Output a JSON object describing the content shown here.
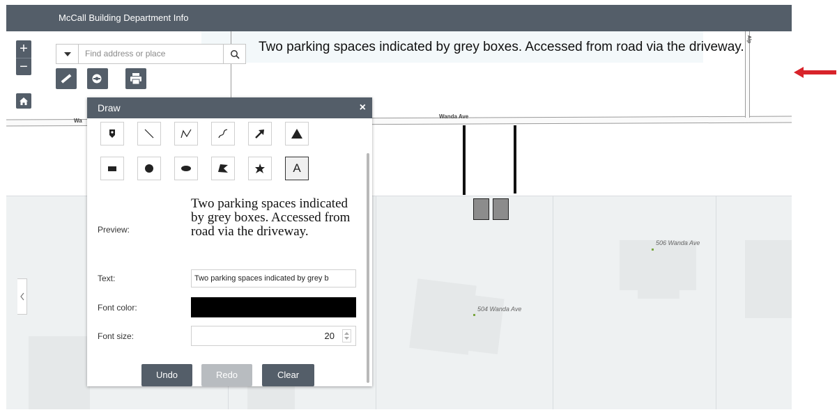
{
  "header": {
    "title": "McCall Building Department Info"
  },
  "map": {
    "annotation_text": "Two parking spaces indicated by grey boxes. Accessed from road via the driveway.",
    "street_name": "Wanda Ave",
    "street_name_left": "Wa",
    "street_vertical": "Alp",
    "addresses": [
      "506 Wanda Ave",
      "504 Wanda Ave"
    ]
  },
  "controls": {
    "zoom_in": "+",
    "zoom_out": "−"
  },
  "search": {
    "placeholder": "Find address or place"
  },
  "draw": {
    "title": "Draw",
    "close": "×",
    "text_symbol": "A",
    "labels": {
      "preview": "Preview:",
      "text": "Text:",
      "font_color": "Font color:",
      "font_size": "Font size:"
    },
    "preview_text": "Two parking spaces indicated by grey boxes. Accessed from road via the driveway.",
    "text_value": "Two parking spaces indicated by grey b",
    "font_color": "#000000",
    "font_size": "20",
    "buttons": {
      "undo": "Undo",
      "redo": "Redo",
      "clear": "Clear"
    }
  },
  "colors": {
    "header_bg": "#545e69",
    "button_dark": "#545e69",
    "button_disabled": "#b8bcc0",
    "arrow_red": "#d8232a"
  }
}
